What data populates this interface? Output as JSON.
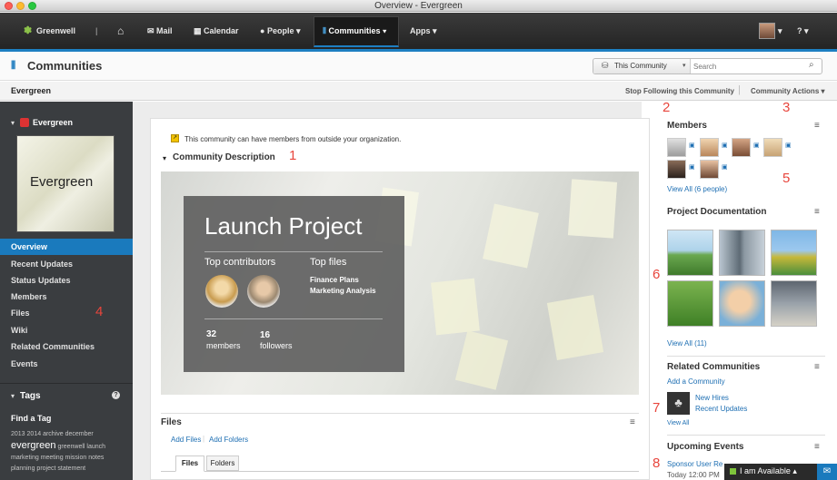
{
  "window": {
    "title": "Overview - Evergreen"
  },
  "nav": {
    "brand": "Greenwell",
    "items": [
      {
        "label": "Mail",
        "icon": "mail-icon"
      },
      {
        "label": "Calendar",
        "icon": "calendar-icon"
      },
      {
        "label": "People ▾",
        "icon": "person-icon"
      },
      {
        "label": "Communities ▾",
        "icon": "communities-icon"
      },
      {
        "label": "Apps ▾",
        "icon": ""
      }
    ],
    "help": "? ▾"
  },
  "page": {
    "title": "Communities",
    "search_scope": "This Community",
    "search_placeholder": "Search",
    "breadcrumb": "Evergreen",
    "stop_following": "Stop Following this Community",
    "community_actions": "Community Actions ▾"
  },
  "sidebar": {
    "community_name": "Evergreen",
    "logo_text": "Evergreen",
    "items": [
      "Overview",
      "Recent Updates",
      "Status Updates",
      "Members",
      "Files",
      "Wiki",
      "Related Communities",
      "Events"
    ],
    "tags_header": "Tags",
    "find_tag": "Find a Tag",
    "tags": [
      "2013",
      "2014",
      "archive",
      "december",
      "evergreen",
      "greenwell",
      "launch",
      "marketing",
      "meeting",
      "mission",
      "notes",
      "planning",
      "project",
      "statement"
    ]
  },
  "main": {
    "notice": "This community can have members from outside your organization.",
    "description_header": "Community Description",
    "banner": {
      "title": "Launch Project",
      "contributors_label": "Top contributors",
      "files_label": "Top files",
      "files": [
        "Finance Plans",
        "Marketing Analysis"
      ],
      "members_count": "32",
      "members_label": "members",
      "followers_count": "16",
      "followers_label": "followers"
    },
    "files": {
      "header": "Files",
      "add_files": "Add Files",
      "add_folders": "Add Folders",
      "tabs": [
        "Files",
        "Folders"
      ]
    }
  },
  "right": {
    "members": {
      "header": "Members",
      "view_all": "View All (6 people)"
    },
    "docs": {
      "header": "Project Documentation",
      "view_all": "View All (11)"
    },
    "related": {
      "header": "Related Communities",
      "add": "Add a Community",
      "item_name": "New Hires",
      "item_updates": "Recent Updates",
      "view_all": "View All"
    },
    "events": {
      "header": "Upcoming Events",
      "item": "Sponsor User Re",
      "time": "Today 12:00 PM"
    }
  },
  "chat": {
    "status": "I am Available ▴"
  },
  "callouts": [
    "1",
    "2",
    "3",
    "4",
    "5",
    "6",
    "7",
    "8"
  ],
  "colors": {
    "accent": "#1a7abd",
    "nav": "#2b2b2b",
    "callout": "#e8453c"
  }
}
